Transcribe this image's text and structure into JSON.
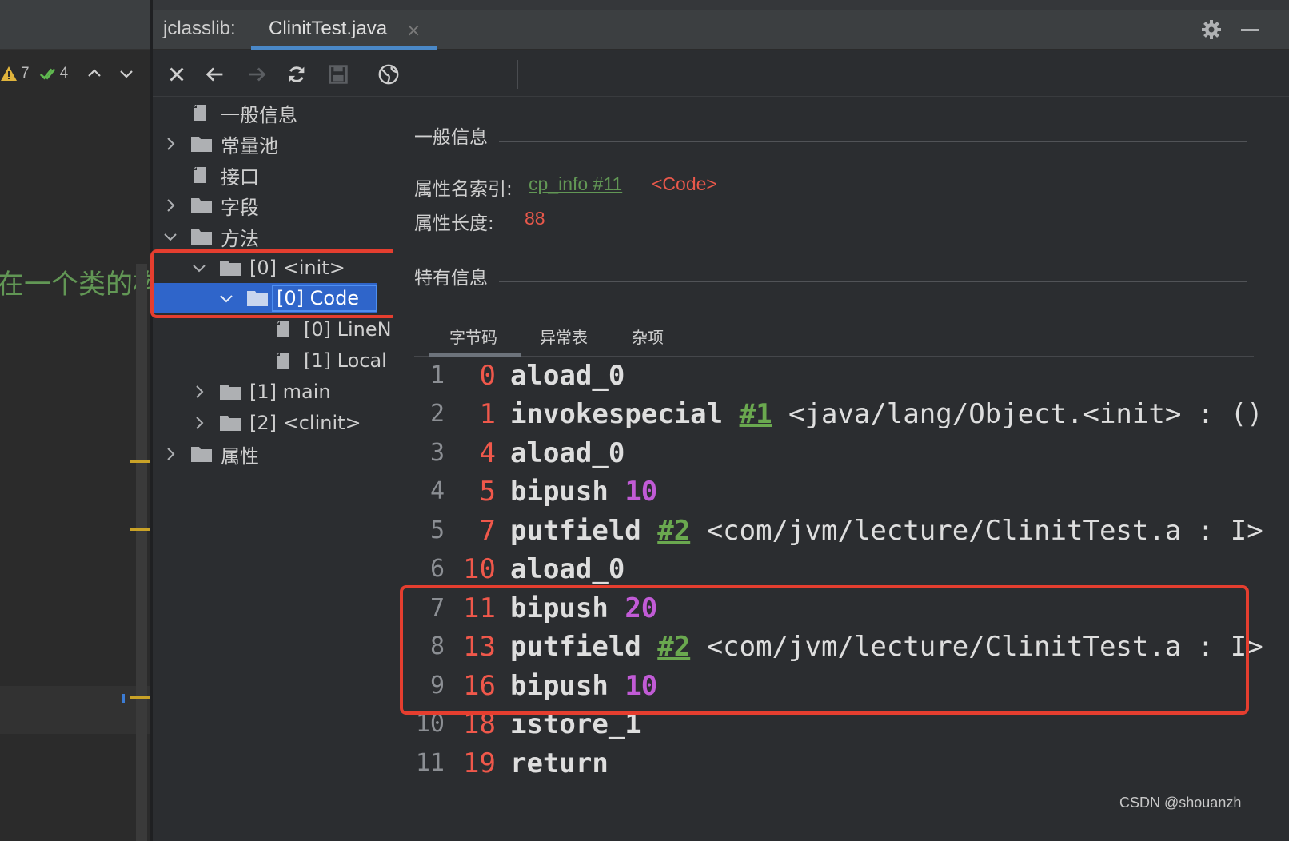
{
  "editor": {
    "inspections": {
      "warnings": "7",
      "passed": "4"
    },
    "visible_text": "在一个类的构"
  },
  "toolwindow": {
    "title": "jclasslib:",
    "tab_label": "ClinitTest.java",
    "tab_close": "×"
  },
  "toolbar": {
    "buttons": [
      "close-icon",
      "back-icon",
      "forward-icon",
      "refresh-icon",
      "save-icon",
      "web-icon"
    ]
  },
  "tree": {
    "items": [
      {
        "label": "一般信息",
        "type": "file"
      },
      {
        "label": "常量池",
        "type": "folder",
        "expanded": false
      },
      {
        "label": "接口",
        "type": "file"
      },
      {
        "label": "字段",
        "type": "folder",
        "expanded": false
      },
      {
        "label": "方法",
        "type": "folder",
        "expanded": true
      },
      {
        "label": "[0] <init>",
        "type": "folder",
        "expanded": true
      },
      {
        "label": "[0] Code",
        "type": "folder",
        "expanded": true,
        "selected": true
      },
      {
        "label": "[0] LineN",
        "type": "file"
      },
      {
        "label": "[1] Local",
        "type": "file"
      },
      {
        "label": "[1] main",
        "type": "folder",
        "expanded": false
      },
      {
        "label": "[2] <clinit>",
        "type": "folder",
        "expanded": false
      },
      {
        "label": "属性",
        "type": "folder",
        "expanded": false
      }
    ]
  },
  "detail": {
    "general_title": "一般信息",
    "attr_name_index_label": "属性名索引:",
    "attr_name_index_link": "cp_info #11",
    "attr_name_index_value": "<Code>",
    "attr_length_label": "属性长度:",
    "attr_length_value": "88",
    "specific_title": "特有信息",
    "tabs": [
      "字节码",
      "异常表",
      "杂项"
    ]
  },
  "bytecode": [
    {
      "line": "1",
      "offset": "0",
      "op": "aload_0"
    },
    {
      "line": "2",
      "offset": "1",
      "op": "invokespecial",
      "ref": "#1",
      "comment": "<java/lang/Object.<init> : ()"
    },
    {
      "line": "3",
      "offset": "4",
      "op": "aload_0"
    },
    {
      "line": "4",
      "offset": "5",
      "op": "bipush",
      "arg": "10"
    },
    {
      "line": "5",
      "offset": "7",
      "op": "putfield",
      "ref": "#2",
      "comment": "<com/jvm/lecture/ClinitTest.a : I>"
    },
    {
      "line": "6",
      "offset": "10",
      "op": "aload_0"
    },
    {
      "line": "7",
      "offset": "11",
      "op": "bipush",
      "arg": "20"
    },
    {
      "line": "8",
      "offset": "13",
      "op": "putfield",
      "ref": "#2",
      "comment": "<com/jvm/lecture/ClinitTest.a : I>"
    },
    {
      "line": "9",
      "offset": "16",
      "op": "bipush",
      "arg": "10"
    },
    {
      "line": "10",
      "offset": "18",
      "op": "istore_1"
    },
    {
      "line": "11",
      "offset": "19",
      "op": "return"
    }
  ],
  "watermark": "CSDN @shouanzh",
  "colors": {
    "selection": "#2f65ca",
    "highlight_box": "#e53e2f",
    "offset": "#f0584b",
    "number_arg": "#c15bd6",
    "ref_link": "#6aa84f",
    "tab_underline": "#4a88c7"
  }
}
